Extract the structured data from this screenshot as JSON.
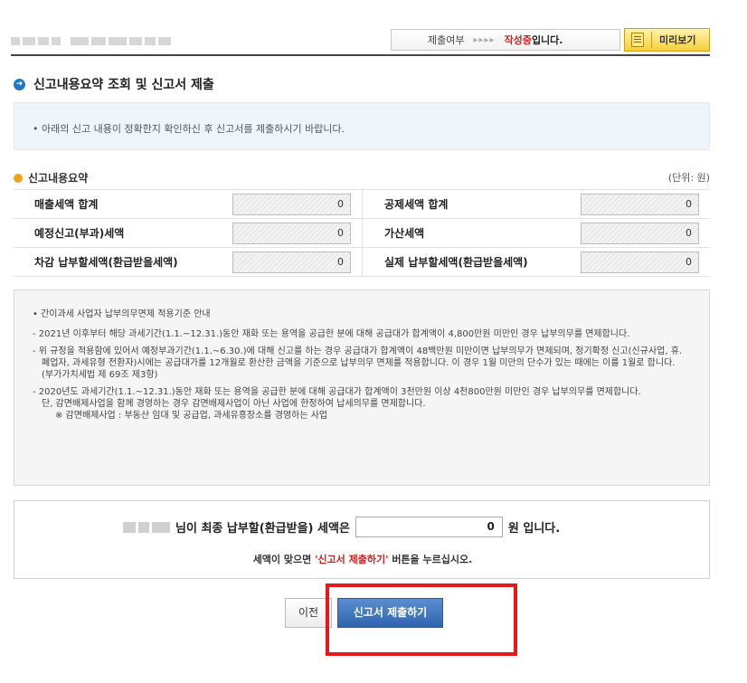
{
  "header": {
    "status_label": "제출여부",
    "status_arrows": "▸▸▸▸",
    "status_value": "작성중",
    "status_suffix": "입니다.",
    "preview_button": "미리보기"
  },
  "section_title": "신고내용요약 조회 및 신고서 제출",
  "notice_text": "• 아래의 신고 내용이 정확한지 확인하신 후 신고서를 제출하시기 바랍니다.",
  "summary": {
    "title": "신고내용요약",
    "unit": "(단위: 원)",
    "rows": [
      {
        "left_label": "매출세액 합계",
        "left_value": "0",
        "right_label": "공제세액 합계",
        "right_value": "0"
      },
      {
        "left_label": "예정신고(부과)세액",
        "left_value": "0",
        "right_label": "가산세액",
        "right_value": "0"
      },
      {
        "left_label": "차감 납부할세액(환급받을세액)",
        "left_value": "0",
        "right_label": "실제 납부할세액(환급받을세액)",
        "right_value": "0"
      }
    ]
  },
  "guide": {
    "heading": "• 간이과세 사업자 납부의무면제 적용기준 안내",
    "items": [
      "- 2021년 이후부터 해당  과세기간(1.1.~12.31.)동안 재화 또는 용역을 공급한 분에 대해 공급대가 합계액이 4,800만원 미만인 경우 납부의무를 면제합니다.",
      "- 위 규정을 적용함에 있어서 예정부과기간(1.1.~6.30.)에 대해 신고를 하는 경우 공급대가 합계액이 48백만원 미만이면 납부의무가 면제되며, 정기확정 신고(신규사업, 휴.폐업자, 과세유형 전환자)시에는 공급대가를 12개월로 환산한 금액을 기준으로 납부의무 면제를 적용합니다. 이 경우 1월 미만의 단수가 있는 때에는 이를 1월로 합니다.(부가가치세법 제 69조 제3항)",
      "- 2020년도 과세기간(1.1.~12.31.)동안 재화 또는 용역을 공급한 분에 대해 공급대가 합계액이 3천만원 이상 4천800만원 미만인 경우 납부의무를 면제합니다.",
      "단, 감면배제사업을 함께 경영하는 경우 감면배제사업이 아닌 사업에 한정하여 납세의무를 면제합니다."
    ],
    "note": "※ 감면배제사업 : 부동산 임대 및 공급업, 과세유흥장소를 경영하는 사업"
  },
  "final": {
    "text_before": "님이 최종 납부할(환급받을) 세액은",
    "amount": "0",
    "text_after": "원 입니다.",
    "hint_before": "세액이 맞으면 ",
    "hint_red": "'신고서 제출하기'",
    "hint_after": " 버튼을 누르십시오."
  },
  "buttons": {
    "prev": "이전",
    "submit": "신고서 제출하기"
  },
  "colors": {
    "accent_blue": "#2f64ae",
    "status_red": "#d41e1e",
    "highlight_red": "#e8171c",
    "preview_yellow": "#f7cf3a"
  }
}
